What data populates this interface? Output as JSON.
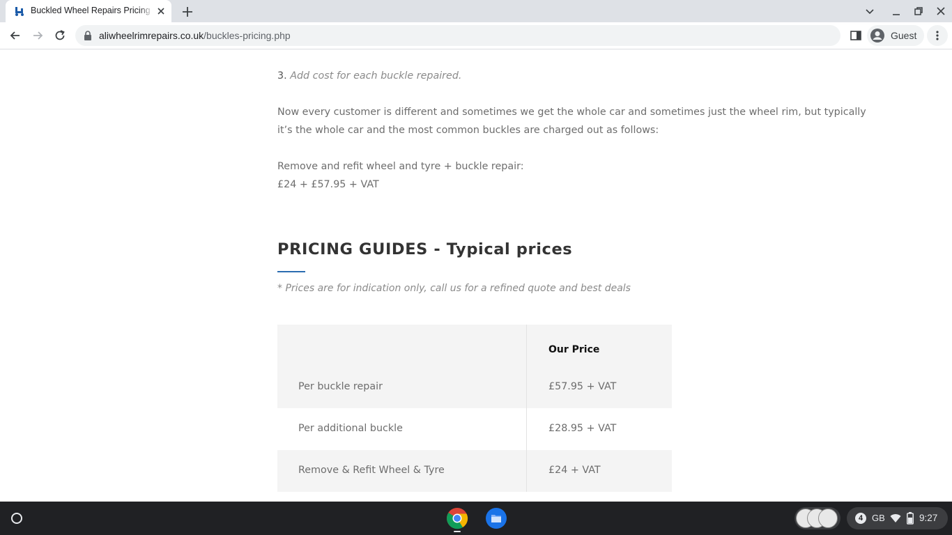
{
  "browser": {
    "tab": {
      "title": "Buckled Wheel Repairs Pricing | Ali Wheel Rim Repairs",
      "close_icon": "close-icon",
      "favicon": "wheelchair-icon"
    },
    "new_tab_icon": "plus-icon",
    "window_controls": [
      "chevron-down-icon",
      "minimize-icon",
      "restore-icon",
      "close-icon"
    ],
    "url_host": "aliwheelrimrepairs.co.uk",
    "url_path": "/buckles-pricing.php",
    "profile_label": "Guest"
  },
  "page": {
    "step_number": "3.",
    "step_text": "Add cost for each buckle repaired.",
    "paragraph1": "Now every customer is different and sometimes we get the whole car and sometimes just the wheel rim, but typically it’s the whole car and the most common buckles are charged out as follows:",
    "paragraph2_line1": "Remove and refit wheel and tyre + buckle repair:",
    "paragraph2_line2": "£24 + £57.95 + VAT",
    "heading": "PRICING GUIDES - Typical prices",
    "note": "* Prices are for indication only, call us for a refined quote and best deals",
    "table": {
      "header": [
        "",
        "Our Price"
      ],
      "rows": [
        {
          "item": "Per buckle repair",
          "price": "£57.95 + VAT"
        },
        {
          "item": "Per additional buckle",
          "price": "£28.95 + VAT"
        },
        {
          "item": "Remove & Refit Wheel & Tyre",
          "price": "£24 + VAT"
        }
      ]
    }
  },
  "shelf": {
    "apps": [
      "chrome-icon",
      "files-icon"
    ],
    "tray": {
      "notification_count": "4",
      "storage": "GB",
      "time": "9:27"
    }
  },
  "colors": {
    "accent_rule": "#2b6cb0",
    "tab_strip": "#dee1e6",
    "shelf": "#202124"
  }
}
